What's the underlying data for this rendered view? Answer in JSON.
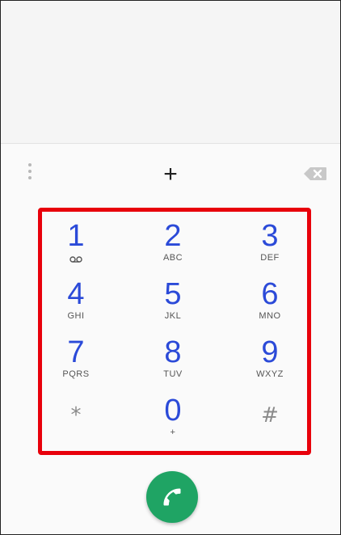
{
  "dialer": {
    "number_display": "+",
    "overflow_icon": "more-vert-icon",
    "backspace_icon": "backspace-icon",
    "call_icon": "phone-icon",
    "colors": {
      "digit": "#2b4ad8",
      "call_button": "#1fa464",
      "highlight_border": "#e8000b"
    },
    "keys": [
      {
        "digit": "1",
        "letters": "",
        "icon": "voicemail-icon"
      },
      {
        "digit": "2",
        "letters": "ABC"
      },
      {
        "digit": "3",
        "letters": "DEF"
      },
      {
        "digit": "4",
        "letters": "GHI"
      },
      {
        "digit": "5",
        "letters": "JKL"
      },
      {
        "digit": "6",
        "letters": "MNO"
      },
      {
        "digit": "7",
        "letters": "PQRS"
      },
      {
        "digit": "8",
        "letters": "TUV"
      },
      {
        "digit": "9",
        "letters": "WXYZ"
      },
      {
        "digit": "*",
        "letters": ""
      },
      {
        "digit": "0",
        "letters": "+"
      },
      {
        "digit": "#",
        "letters": ""
      }
    ]
  }
}
